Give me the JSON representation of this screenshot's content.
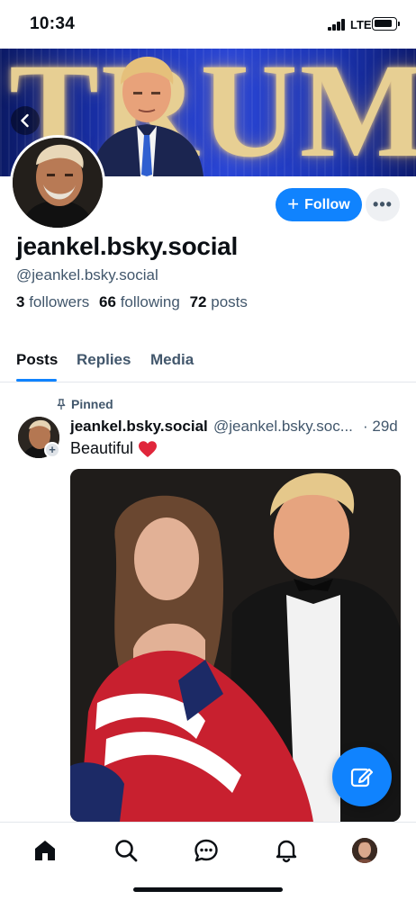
{
  "status_bar": {
    "time": "10:34",
    "network": "LTE"
  },
  "banner": {
    "word": "TRUMP"
  },
  "profile": {
    "display_name": "jeankel.bsky.social",
    "handle": "@jeankel.bsky.social",
    "follow_label": "Follow",
    "followers_count": "3",
    "followers_label": "followers",
    "following_count": "66",
    "following_label": "following",
    "posts_count": "72",
    "posts_label": "posts"
  },
  "tabs": [
    {
      "label": "Posts",
      "active": true
    },
    {
      "label": "Replies",
      "active": false
    },
    {
      "label": "Media",
      "active": false
    }
  ],
  "post": {
    "pinned_label": "Pinned",
    "author": "jeankel.bsky.social",
    "handle": "@jeankel.bsky.soc...",
    "time": "· 29d",
    "text": "Beautiful"
  },
  "colors": {
    "accent": "#1083fe",
    "text_secondary": "#42576c",
    "heart": "#e0263b"
  },
  "icons": [
    "back-icon",
    "more-icon",
    "pin-icon",
    "heart-icon",
    "compose-icon",
    "home-icon",
    "search-icon",
    "chat-icon",
    "bell-icon"
  ]
}
